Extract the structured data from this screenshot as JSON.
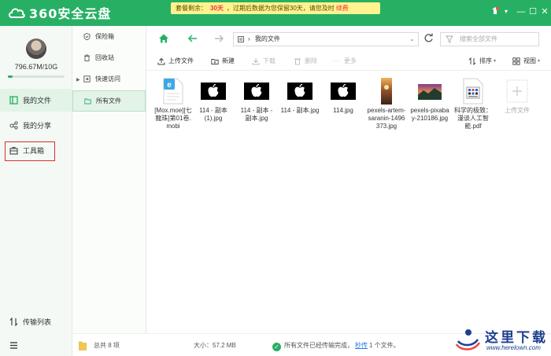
{
  "app": {
    "title": "360安全云盘"
  },
  "notice": {
    "prefix": "套餐剩余：",
    "days": "30天",
    "message": "，过期后数据为您保留30天，请您及时",
    "renew": "续费"
  },
  "window_controls": {
    "skin": "skin-icon",
    "menu": "▾",
    "minimize": "—",
    "maximize": "☐",
    "close": "✕"
  },
  "sidebar": {
    "quota": "796.67M/10G",
    "quota_fraction": 0.08,
    "items": [
      {
        "label": "我的文件",
        "icon": "file-icon"
      },
      {
        "label": "我的分享",
        "icon": "share-icon"
      },
      {
        "label": "工具箱",
        "icon": "toolbox-icon"
      }
    ],
    "transfer": "传输列表"
  },
  "folders": [
    {
      "label": "保险箱",
      "icon": "safe-icon"
    },
    {
      "label": "回收站",
      "icon": "trash-icon"
    },
    {
      "label": "快速访问",
      "icon": "quick-access-icon"
    },
    {
      "label": "所有文件",
      "icon": "folder-icon"
    }
  ],
  "navbar": {
    "path": "我的文件",
    "search_placeholder": "搜索全部文件"
  },
  "toolbar": {
    "upload": "上传文件",
    "new": "新建",
    "download": "下载",
    "delete": "删除",
    "more": "更多",
    "sort": "排序",
    "view": "视图"
  },
  "files": [
    {
      "name": "[Mox.moe][七龍珠]第01卷.mobi",
      "type": "mobi"
    },
    {
      "name": "114 - 副本 (1).jpg",
      "type": "apple-jpg"
    },
    {
      "name": "114 - 副本 - 副本.jpg",
      "type": "apple-jpg"
    },
    {
      "name": "114 - 副本.jpg",
      "type": "apple-jpg"
    },
    {
      "name": "114.jpg",
      "type": "apple-jpg"
    },
    {
      "name": "pexels-artem-saranin-1496373.jpg",
      "type": "photo-portrait"
    },
    {
      "name": "pexels-pixabay-210186.jpg",
      "type": "photo-landscape"
    },
    {
      "name": "科学的极致：漫谈人工智能.pdf",
      "type": "pdf"
    },
    {
      "name": "上传文件",
      "type": "upload"
    }
  ],
  "status": {
    "total": "总共 8 项",
    "size": "大小：57.2 MB",
    "done": "所有文件已经传输完成，",
    "seconds": "秒传",
    "count": "1 个文件。"
  },
  "watermark": {
    "text": "这里下载",
    "url": "www.herelown.com"
  },
  "colors": {
    "brand": "#27b064",
    "notice_bg": "#fff28f",
    "alert": "#e33333",
    "highlight_border": "#d9312b"
  }
}
